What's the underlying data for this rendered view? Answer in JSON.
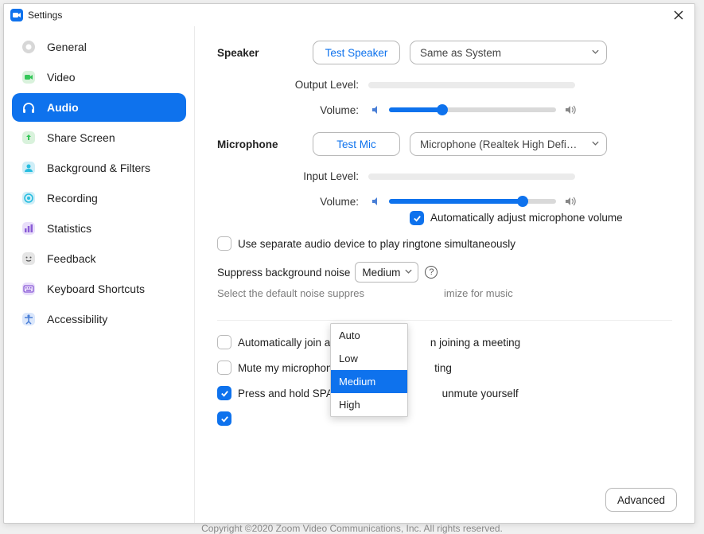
{
  "window": {
    "title": "Settings"
  },
  "sidebar": {
    "items": [
      {
        "label": "General"
      },
      {
        "label": "Video"
      },
      {
        "label": "Audio"
      },
      {
        "label": "Share Screen"
      },
      {
        "label": "Background & Filters"
      },
      {
        "label": "Recording"
      },
      {
        "label": "Statistics"
      },
      {
        "label": "Feedback"
      },
      {
        "label": "Keyboard Shortcuts"
      },
      {
        "label": "Accessibility"
      }
    ]
  },
  "speaker": {
    "section": "Speaker",
    "test_label": "Test Speaker",
    "device": "Same as System",
    "output_label": "Output Level:",
    "volume_label": "Volume:",
    "volume_pct": 32
  },
  "mic": {
    "section": "Microphone",
    "test_label": "Test Mic",
    "device": "Microphone (Realtek High Definit…",
    "input_label": "Input Level:",
    "volume_label": "Volume:",
    "volume_pct": 80,
    "auto_label": "Automatically adjust microphone volume",
    "auto_checked": true
  },
  "ringtone": {
    "label": "Use separate audio device to play ringtone simultaneously",
    "checked": false
  },
  "noise": {
    "label": "Suppress background noise",
    "value": "Medium",
    "options": [
      "Auto",
      "Low",
      "Medium",
      "High"
    ],
    "selected_index": 2,
    "hint_prefix": "Select the default noise suppres",
    "hint_suffix": "imize for music"
  },
  "options": {
    "auto_join": {
      "label_prefix": "Automatically join audio",
      "label_suffix": "n joining a meeting",
      "checked": false
    },
    "mute_mic": {
      "label_prefix": "Mute my microphone wh",
      "label_suffix": "ting",
      "checked": false
    },
    "space_key": {
      "label_prefix": "Press and hold SPACE ke",
      "label_suffix": "unmute yourself",
      "checked": true
    }
  },
  "footer": {
    "advanced": "Advanced"
  },
  "copyright": "Copyright ©2020 Zoom Video Communications, Inc. All rights reserved."
}
